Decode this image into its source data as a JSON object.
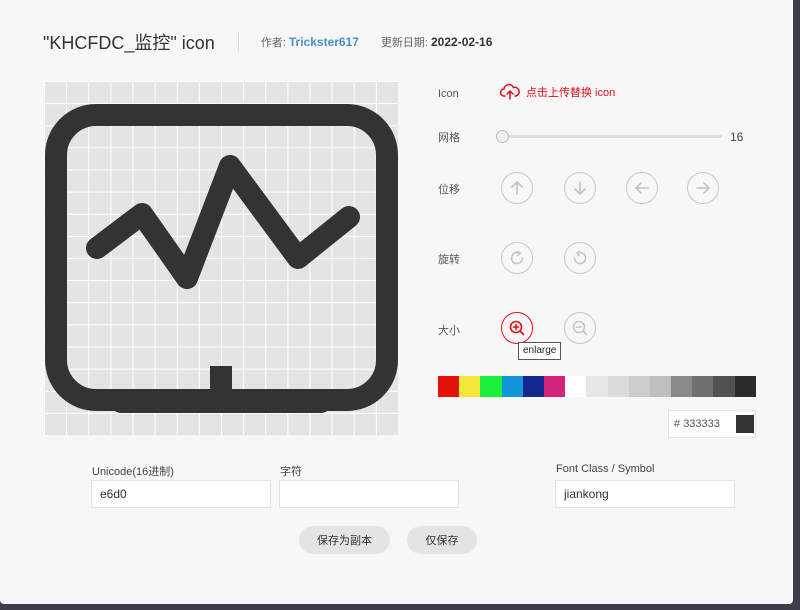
{
  "header": {
    "title": "\"KHCFDC_监控\" icon",
    "author_label": "作者:",
    "author": "Trickster617",
    "date_label": "更新日期:",
    "date": "2022-02-16"
  },
  "icon_row": {
    "label": "Icon",
    "upload_label": "点击上传替换 icon"
  },
  "grid_row": {
    "label": "网格",
    "value": "16"
  },
  "move_row": {
    "label": "位移"
  },
  "rotate_row": {
    "label": "旋转"
  },
  "size_row": {
    "label": "大小",
    "tooltip": "enlarge"
  },
  "palette": [
    "#e3120b",
    "#f5e73a",
    "#1aef3c",
    "#1296db",
    "#12288f",
    "#d4237a",
    "#ffffff",
    "#e6e6e6",
    "#dbdbdb",
    "#cdcdcd",
    "#bfbfbf",
    "#8a8a8a",
    "#707070",
    "#515151",
    "#2c2c2c"
  ],
  "color": {
    "hash": "#",
    "hex": "333333",
    "value": "#333333"
  },
  "fields": {
    "unicode_label": "Unicode(16进制)",
    "unicode_value": "e6d0",
    "char_label": "字符",
    "char_value": "",
    "fontclass_label": "Font Class / Symbol",
    "fontclass_value": "jiankong"
  },
  "buttons": {
    "save_copy": "保存为副本",
    "save_only": "仅保存"
  }
}
